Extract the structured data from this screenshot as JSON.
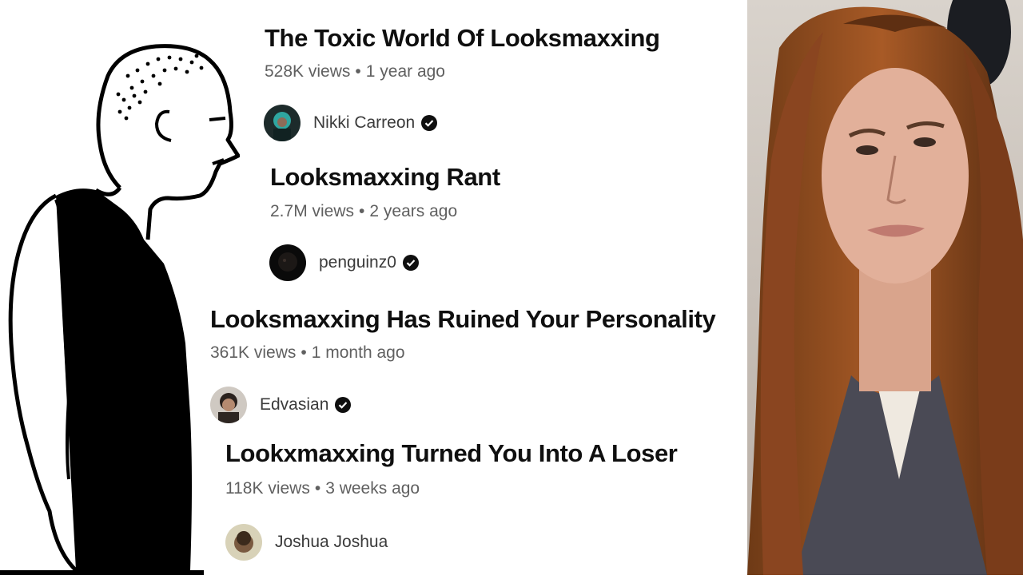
{
  "results": [
    {
      "title": "The Toxic World Of Looksmaxxing",
      "views": "528K views",
      "age": "1 year ago",
      "channel": "Nikki Carreon",
      "verified": true
    },
    {
      "title": "Looksmaxxing Rant",
      "views": "2.7M views",
      "age": "2 years ago",
      "channel": "penguinz0",
      "verified": true
    },
    {
      "title": "Looksmaxxing Has Ruined Your Personality",
      "views": "361K views",
      "age": "1 month ago",
      "channel": "Edvasian",
      "verified": true
    },
    {
      "title": "Lookxmaxxing Turned You Into A Loser",
      "views": "118K views",
      "age": "3 weeks ago",
      "channel": "Joshua Joshua",
      "verified": false
    }
  ],
  "separator": "•"
}
